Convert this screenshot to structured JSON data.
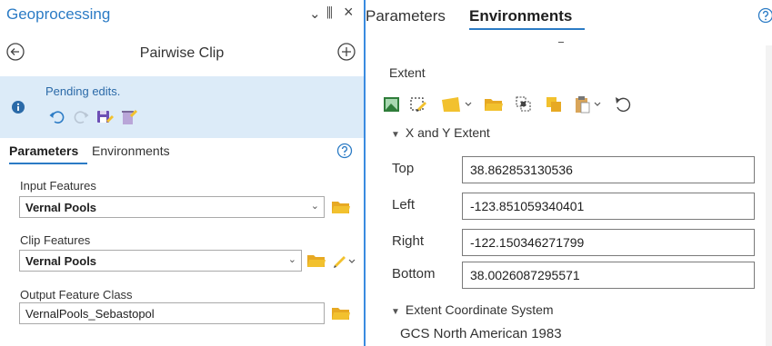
{
  "left_pane": {
    "title": "Geoprocessing",
    "window_controls": {
      "menu": "⌄",
      "pin": "⫼",
      "close": "×"
    },
    "tool_name": "Pairwise Clip",
    "pending": {
      "message": "Pending edits."
    },
    "tabs": [
      {
        "label": "Parameters",
        "active": true
      },
      {
        "label": "Environments",
        "active": false
      }
    ],
    "params": {
      "input_features": {
        "label": "Input Features",
        "value": "Vernal Pools"
      },
      "clip_features": {
        "label": "Clip Features",
        "value": "Vernal Pools"
      },
      "output_feature_class": {
        "label": "Output Feature Class",
        "value": "VernalPools_Sebastopol"
      }
    }
  },
  "right_pane": {
    "tabs": [
      {
        "label": "Parameters",
        "active": false
      },
      {
        "label": "Environments",
        "active": true
      }
    ],
    "extent_label": "Extent",
    "xy_extent": {
      "header": "X and Y Extent",
      "top": {
        "label": "Top",
        "value": "38.862853130536"
      },
      "left": {
        "label": "Left",
        "value": "-123.851059340401"
      },
      "right": {
        "label": "Right",
        "value": "-122.150346271799"
      },
      "bottom": {
        "label": "Bottom",
        "value": "38.0026087295571"
      }
    },
    "coordinate_system": {
      "header": "Extent Coordinate System",
      "value": "GCS North American 1983"
    }
  },
  "colors": {
    "accent": "#2b7bc5",
    "pending_bg": "#dcebf8",
    "folder_yellow": "#f2c12e"
  }
}
